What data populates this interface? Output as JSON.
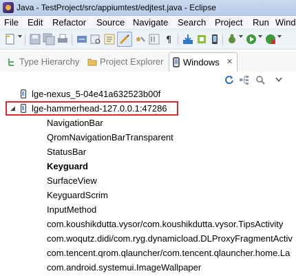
{
  "window": {
    "title": "Java - TestProject/src/appiumtest/edjtest.java - Eclipse"
  },
  "menu": [
    "File",
    "Edit",
    "Refactor",
    "Source",
    "Navigate",
    "Search",
    "Project",
    "Run",
    "Wind"
  ],
  "tabs": [
    {
      "label": "Type Hierarchy",
      "active": false
    },
    {
      "label": "Project Explorer",
      "active": false
    },
    {
      "label": "Windows",
      "active": true
    }
  ],
  "devices": [
    {
      "name": "lge-nexus_5-04e41a632523b00f",
      "expanded": false
    },
    {
      "name": "lge-hammerhead-127.0.0.1:47286",
      "expanded": true
    }
  ],
  "windows": [
    {
      "name": "NavigationBar",
      "bold": false
    },
    {
      "name": "QromNavigationBarTransparent",
      "bold": false
    },
    {
      "name": "StatusBar",
      "bold": false
    },
    {
      "name": "Keyguard",
      "bold": true
    },
    {
      "name": "SurfaceView",
      "bold": false
    },
    {
      "name": "KeyguardScrim",
      "bold": false
    },
    {
      "name": "InputMethod",
      "bold": false
    },
    {
      "name": "com.koushikdutta.vysor/com.koushikdutta.vysor.TipsActivity",
      "bold": false
    },
    {
      "name": "com.woqutz.didi/com.ryg.dynamicload.DLProxyFragmentActiv",
      "bold": false
    },
    {
      "name": "com.tencent.qrom.qlauncher/com.tencent.qlauncher.home.La",
      "bold": false
    },
    {
      "name": "com.android.systemui.ImageWallpaper",
      "bold": false
    }
  ],
  "colors": {
    "highlight": "#e02828",
    "title_bg": "#c9d9ee"
  }
}
